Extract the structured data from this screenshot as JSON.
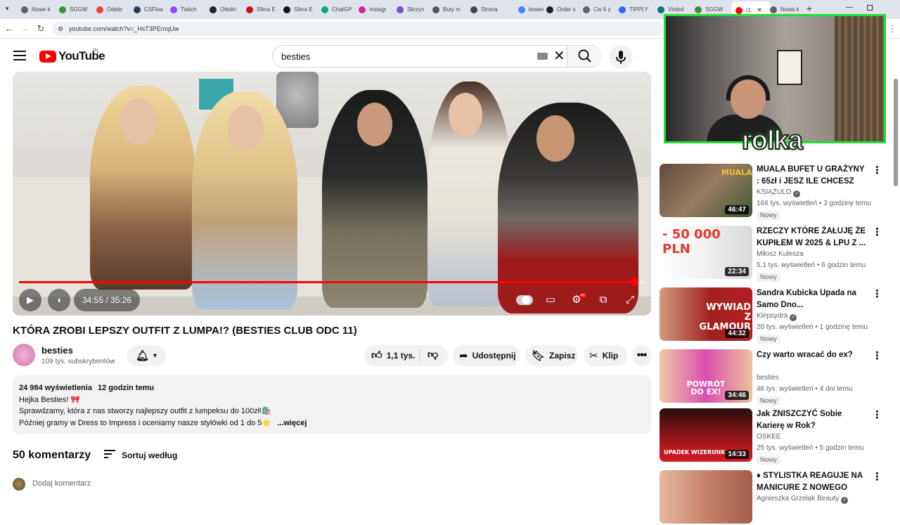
{
  "browser": {
    "tabs": [
      {
        "label": "Nowe k",
        "color": "#5f6368"
      },
      {
        "label": "SGGW",
        "color": "#3b8f3b"
      },
      {
        "label": "Odebr",
        "color": "#ea4335"
      },
      {
        "label": "CSFloa",
        "color": "#2b3c5a"
      },
      {
        "label": "Twitch",
        "color": "#9146ff"
      },
      {
        "label": "Ottolin",
        "color": "#222222"
      },
      {
        "label": "Sfera E",
        "color": "#cc1111"
      },
      {
        "label": "Sfera E",
        "color": "#111111"
      },
      {
        "label": "ChatGP",
        "color": "#10a37f"
      },
      {
        "label": "Instagr",
        "color": "#d6249f"
      },
      {
        "label": "Skrzyn",
        "color": "#7a4cd8"
      },
      {
        "label": "Buty m",
        "color": "#555555"
      },
      {
        "label": "Strona",
        "color": "#444444"
      },
      {
        "label": "bowen",
        "color": "#4285f4"
      },
      {
        "label": "Order s",
        "color": "#222222"
      },
      {
        "label": "Cw 6 z",
        "color": "#5f6368"
      },
      {
        "label": "TIPPLY",
        "color": "#3366ff"
      },
      {
        "label": "Vinted",
        "color": "#09777b"
      },
      {
        "label": "SGGW",
        "color": "#3b8f3b"
      },
      {
        "label": "(1:",
        "color": "#ff0000"
      },
      {
        "label": "Nowa k",
        "color": "#5f6368"
      }
    ],
    "url": "youtube.com/watch?v=_HsT3PEmqUw"
  },
  "header": {
    "logo_text": "YouTube",
    "country_code": "PL",
    "search_value": "besties"
  },
  "video": {
    "current_time": "34:55",
    "duration": "35:26",
    "time_display": "34:55 / 35:26",
    "progress": 0.985,
    "hd_badge": "4K",
    "title": "KTÓRA ZROBI LEPSZY OUTFIT Z LUMPA!? (BESTIES CLUB ODC 11)",
    "channel": "besties",
    "subscribers": "109 tys. subskrybentów",
    "likes": "1,1 tys.",
    "share_label": "Udostępnij",
    "save_label": "Zapisz",
    "clip_label": "Klip"
  },
  "description": {
    "views": "24 984 wyświetlenia",
    "posted": "12 godzin temu",
    "line1": "Hejka Besties! 🎀",
    "line2": "Sprawdzamy, która z nas stworzy najlepszy outfit z lumpeksu do 100zł!🛍️",
    "line3": "Później gramy w Dress to Impress i oceniamy nasze stylówki od 1 do 5⭐",
    "more_label": "...więcej"
  },
  "comments": {
    "count_label": "50 komentarzy",
    "sort_label": "Sortuj według",
    "add_placeholder": "Dodaj komentarz"
  },
  "overlay": {
    "label": "rolka"
  },
  "recommendations": [
    {
      "title": "MUALA BUFET U GRAŻYNY : 65zł i JESZ ILE CHCESZ",
      "channel": "KSIĄŻULO",
      "verified": true,
      "views": "166 tys. wyświetleń • 3 godziny temu",
      "badge": "Nowy",
      "duration": "46:47",
      "thumb_text": "MUALA"
    },
    {
      "title": "RZECZY KTÓRE ŻAŁUJĘ ŻE KUPIŁEM W 2025 & LPU Z ...",
      "channel": "Miłosz Kulesza",
      "verified": false,
      "views": "5,1 tys. wyświetleń • 6 godzin temu",
      "badge": "Nowy",
      "duration": "22:34",
      "thumb_text": "- 50 000 PLN"
    },
    {
      "title": "Sandra Kubicka Upada na Samo Dno...",
      "channel": "Klepsydra",
      "verified": true,
      "views": "20 tys. wyświetleń • 1 godzinę temu",
      "badge": "Nowy",
      "duration": "44:32",
      "thumb_text": "WYWIAD Z GLAMOUR"
    },
    {
      "title": "Czy warto wracać do ex?",
      "channel": "besties",
      "verified": false,
      "views": "46 tys. wyświetleń • 4 dni temu",
      "badge": "Nowy",
      "duration": "34:46",
      "thumb_text": "POWRÓT DO EX!"
    },
    {
      "title": "Jak ZNISZCZYĆ Sobie Karierę w Rok?",
      "channel": "OSKEE",
      "verified": false,
      "views": "25 tys. wyświetleń • 5 godzin temu",
      "badge": "Nowy",
      "duration": "14:33",
      "thumb_text": "UPADEK WIZERUNKOWY"
    },
    {
      "title": "♦ STYLISTKA REAGUJE NA MANICURE Z NOWEGO JORK...",
      "channel": "Agnieszka Grzelak Beauty",
      "verified": true,
      "views": "",
      "badge": "",
      "duration": "",
      "thumb_text": ""
    }
  ],
  "colors": {
    "accent_red": "#ff0000",
    "overlay_green": "#22dd33",
    "chip_bg": "#f2f2f2",
    "secondary_text": "#606060"
  }
}
